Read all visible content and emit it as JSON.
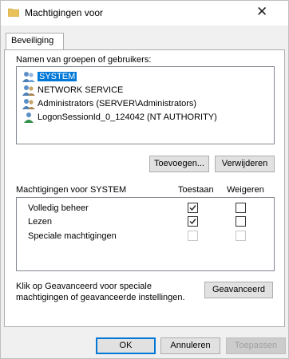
{
  "window": {
    "title": "Machtigingen voor",
    "close_glyph": "✕",
    "icon": "folder-icon"
  },
  "tabs": [
    {
      "label": "Beveiliging"
    }
  ],
  "groups": {
    "label": "Namen van groepen of gebruikers:",
    "items": [
      {
        "label": "SYSTEM",
        "selected": true,
        "icon": "users-group-icon"
      },
      {
        "label": "NETWORK SERVICE",
        "selected": false,
        "icon": "users-group-icon"
      },
      {
        "label": "Administrators (SERVER\\Administrators)",
        "selected": false,
        "icon": "users-group-icon"
      },
      {
        "label": "LogonSessionId_0_124042 (NT AUTHORITY)",
        "selected": false,
        "icon": "user-session-icon"
      }
    ]
  },
  "group_buttons": {
    "add_label": "Toevoegen...",
    "remove_label": "Verwijderen"
  },
  "permissions": {
    "header": "Machtigingen voor SYSTEM",
    "allow_header": "Toestaan",
    "deny_header": "Weigeren",
    "rows": [
      {
        "label": "Volledig beheer",
        "allow": true,
        "deny": false,
        "enabled": true
      },
      {
        "label": "Lezen",
        "allow": true,
        "deny": false,
        "enabled": true
      },
      {
        "label": "Speciale machtigingen",
        "allow": false,
        "deny": false,
        "enabled": false
      }
    ]
  },
  "advanced": {
    "text_line1": "Klik op Geavanceerd voor speciale",
    "text_line2": "machtigingen of geavanceerde instellingen.",
    "button_label": "Geavanceerd"
  },
  "footer": {
    "ok_label": "OK",
    "cancel_label": "Annuleren",
    "apply_label": "Toepassen"
  },
  "colors": {
    "selection": "#0078d7",
    "window_bg": "#f0f0f0",
    "panel_bg": "#ffffff",
    "folder": "#e8c15a"
  }
}
